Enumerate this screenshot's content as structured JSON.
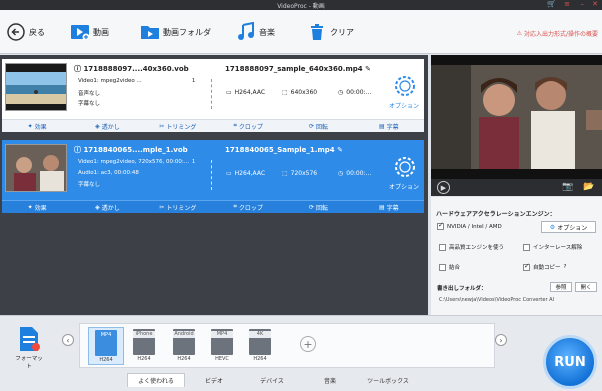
{
  "window": {
    "title": "VideoProc - 動画"
  },
  "toolbar": {
    "back": "戻る",
    "video": "動画",
    "video_folder": "動画フォルダ",
    "music": "音楽",
    "clear": "クリア",
    "help_link": "対応入出力形式/操作の概要"
  },
  "items": [
    {
      "src_name": "1718888097....40x360.vob",
      "video_info": "Video1: mpeg2video ...",
      "audio_info": "音声なし",
      "subtitle_info": "字幕なし",
      "badge": "1",
      "out_name": "1718888097_sample_640x360.mp4",
      "codec": "H264,AAC",
      "resolution": "640x360",
      "duration": "00:00:...",
      "option_label": "オプション",
      "edit": [
        "効果",
        "透かし",
        "トリミング",
        "クロップ",
        "回転",
        "字幕"
      ]
    },
    {
      "src_name": "1718840065....mple_1.vob",
      "video_info": "Video1: mpeg2video, 720x576, 00:00:...",
      "audio_info": "Audio1: ac3, 00:00:48",
      "subtitle_info": "字幕なし",
      "badge": "1",
      "out_name": "1718840065_Sample_1.mp4",
      "codec": "H264,AAC",
      "resolution": "720x576",
      "duration": "00:00:...",
      "option_label": "オプション",
      "edit": [
        "効果",
        "透かし",
        "トリミング",
        "クロップ",
        "回転",
        "字幕"
      ]
    }
  ],
  "settings": {
    "hw_title": "ハードウェアアクセラレーションエンジン：",
    "gpu": "NVIDIA / Intel / AMD",
    "option_button": "オプション",
    "hq_engine": "高品質エンジンを使う",
    "deinterlace": "インターレース解除",
    "merge": "結合",
    "auto_copy": "自動コピー",
    "output_folder_label": "書き出しフォルダ：",
    "browse": "参照",
    "open": "開く",
    "output_path": "C:\\Users\\newja\\Videos\\VideoProc Converter AI"
  },
  "bottom": {
    "format_label": "フォーマット",
    "presets": [
      {
        "tag": "MP4",
        "codec": "H264",
        "selected": true
      },
      {
        "tag": "iPhone",
        "codec": "H264",
        "selected": false
      },
      {
        "tag": "Android",
        "codec": "H264",
        "selected": false
      },
      {
        "tag": "MP4",
        "codec": "HEVC",
        "selected": false
      },
      {
        "tag": "4K",
        "codec": "H264",
        "selected": false
      }
    ],
    "tabs": [
      "よく使われる",
      "ビデオ",
      "デバイス",
      "音楽",
      "ツールボックス"
    ],
    "active_tab": "よく使われる",
    "run": "RUN"
  },
  "colors": {
    "accent": "#2e8be8",
    "run": "#1372d8",
    "help_link": "#d9534f"
  }
}
